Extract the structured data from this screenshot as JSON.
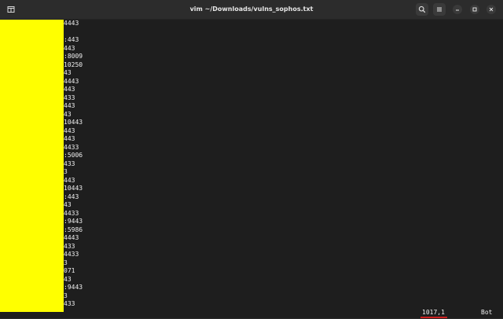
{
  "window": {
    "title": "vim ~/Downloads/vulns_sophos.txt"
  },
  "titlebar_icons": {
    "new_tab": "terminal-tab-icon",
    "search": "search-icon",
    "menu": "hamburger-menu-icon",
    "minimize": "minimize-icon",
    "maximize": "maximize-icon",
    "close": "close-icon"
  },
  "buffer_lines": [
    "4443",
    "",
    ":443",
    "443",
    ":8009",
    "10250",
    "43",
    "4443",
    "443",
    "433",
    "443",
    "43",
    "10443",
    "443",
    "443",
    "4433",
    ":5006",
    "433",
    "3",
    "443",
    "10443",
    ":443",
    "43",
    "4433",
    ":9443",
    ":5986",
    "4443",
    "433",
    "4433",
    "3",
    "071",
    "43",
    ":9443",
    "3",
    "433"
  ],
  "redaction": {
    "color": "#ffff00"
  },
  "status": {
    "position": "1017,1",
    "scroll": "Bot"
  },
  "colors": {
    "terminal_bg": "#1e1e1e",
    "titlebar_bg": "#2c2c2c",
    "text": "#f0f0f0",
    "underline": "#cc1f1f"
  }
}
